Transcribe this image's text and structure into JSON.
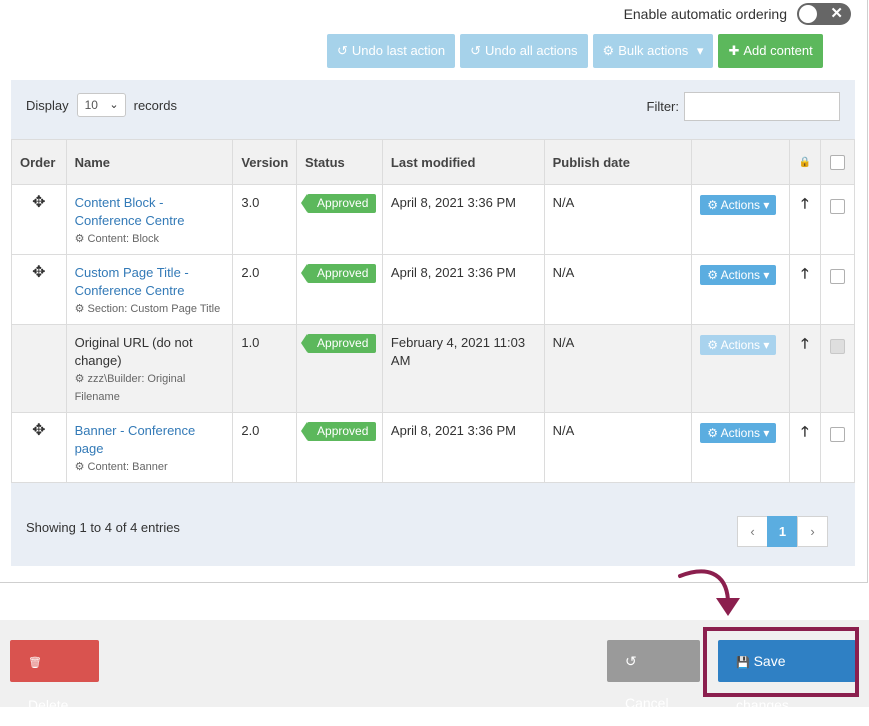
{
  "auto_ordering": {
    "label": "Enable automatic ordering",
    "state": "off",
    "off_symbol": "✕"
  },
  "toolbar": {
    "undo_last": "Undo last action",
    "undo_all": "Undo all actions",
    "bulk": "Bulk actions",
    "add": "Add content",
    "undo_icon": "↺",
    "bulk_icon": "⚙",
    "add_icon": "✚",
    "caret": "▾"
  },
  "listing": {
    "display_label": "Display",
    "display_value": "10",
    "records_label": "records",
    "filter_label": "Filter:",
    "filter_value": ""
  },
  "columns": {
    "order": "Order",
    "name": "Name",
    "version": "Version",
    "status": "Status",
    "last_modified": "Last modified",
    "publish_date": "Publish date",
    "lock_icon": "🔒"
  },
  "rows": [
    {
      "move_icon": "✥",
      "name": "Content Block - Conference Centre",
      "type": "Content: Block",
      "version": "3.0",
      "status": "Approved",
      "modified": "April 8, 2021 3:36 PM",
      "publish": "N/A",
      "actions": "Actions",
      "up": "🡑",
      "link": true,
      "enabled": true
    },
    {
      "move_icon": "✥",
      "name": "Custom Page Title - Conference Centre",
      "type": "Section: Custom Page Title",
      "version": "2.0",
      "status": "Approved",
      "modified": "April 8, 2021 3:36 PM",
      "publish": "N/A",
      "actions": "Actions",
      "up": "🡑",
      "link": true,
      "enabled": true
    },
    {
      "move_icon": "",
      "name": "Original URL (do not change)",
      "type": "zzz\\Builder: Original Filename",
      "version": "1.0",
      "status": "Approved",
      "modified": "February 4, 2021 11:03 AM",
      "publish": "N/A",
      "actions": "Actions",
      "up": "🡑",
      "link": false,
      "enabled": false
    },
    {
      "move_icon": "✥",
      "name": "Banner - Conference page",
      "type": "Content: Banner",
      "version": "2.0",
      "status": "Approved",
      "modified": "April 8, 2021 3:36 PM",
      "publish": "N/A",
      "actions": "Actions",
      "up": "🡑",
      "link": true,
      "enabled": true
    }
  ],
  "pagination": {
    "summary": "Showing 1 to 4 of 4 entries",
    "prev": "‹",
    "current": "1",
    "next": "›"
  },
  "footer": {
    "delete": "Delete",
    "cancel": "Cancel",
    "save": "Save changes",
    "delete_icon": "🗑",
    "cancel_icon": "↺",
    "save_icon": "💾"
  },
  "colors": {
    "primary": "#2f80c4",
    "success": "#5cb85c",
    "danger": "#d9534f",
    "highlight": "#8b1f4e",
    "action_blue": "#5bade0"
  }
}
